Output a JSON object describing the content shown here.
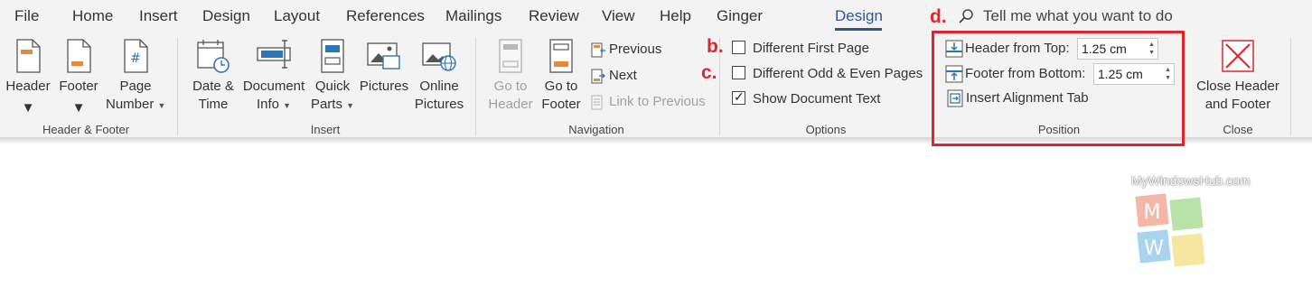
{
  "tabs": [
    "File",
    "Home",
    "Insert",
    "Design",
    "Layout",
    "References",
    "Mailings",
    "Review",
    "View",
    "Help",
    "Ginger",
    "Design"
  ],
  "search": {
    "text": "Tell me what you want to do"
  },
  "groups": {
    "header_footer": {
      "label": "Header & Footer",
      "header_label": "Header",
      "footer_label": "Footer",
      "page_number_line1": "Page",
      "page_number_line2": "Number"
    },
    "insert": {
      "label": "Insert",
      "date_time_line1": "Date &",
      "date_time_line2": "Time",
      "doc_info_line1": "Document",
      "doc_info_line2": "Info",
      "quick_parts_line1": "Quick",
      "quick_parts_line2": "Parts",
      "pictures": "Pictures",
      "online_pictures_line1": "Online",
      "online_pictures_line2": "Pictures"
    },
    "navigation": {
      "label": "Navigation",
      "go_to_header_line1": "Go to",
      "go_to_header_line2": "Header",
      "go_to_footer_line1": "Go to",
      "go_to_footer_line2": "Footer",
      "previous": "Previous",
      "next": "Next",
      "link_to_previous": "Link to Previous"
    },
    "options": {
      "label": "Options",
      "different_first_page": "Different First Page",
      "different_odd_even": "Different Odd & Even Pages",
      "show_document_text": "Show Document Text",
      "different_first_page_checked": false,
      "different_odd_even_checked": false,
      "show_document_text_checked": true
    },
    "position": {
      "label": "Position",
      "header_from_top_label": "Header from Top:",
      "header_from_top_value": "1.25 cm",
      "footer_from_bottom_label": "Footer from Bottom:",
      "footer_from_bottom_value": "1.25 cm",
      "insert_alignment_tab": "Insert Alignment Tab"
    },
    "close": {
      "label": "Close",
      "close_line1": "Close Header",
      "close_line2": "and Footer"
    }
  },
  "annotations": {
    "b": "b.",
    "c": "c.",
    "d": "d."
  },
  "watermark": {
    "text": "MyWindowsHub.com",
    "letter_m": "M",
    "letter_w": "W"
  },
  "colors": {
    "accent": "#2b579a",
    "annotation_red": "#e3242b",
    "icon_orange": "#e8883a",
    "icon_blue": "#2e75b6"
  }
}
